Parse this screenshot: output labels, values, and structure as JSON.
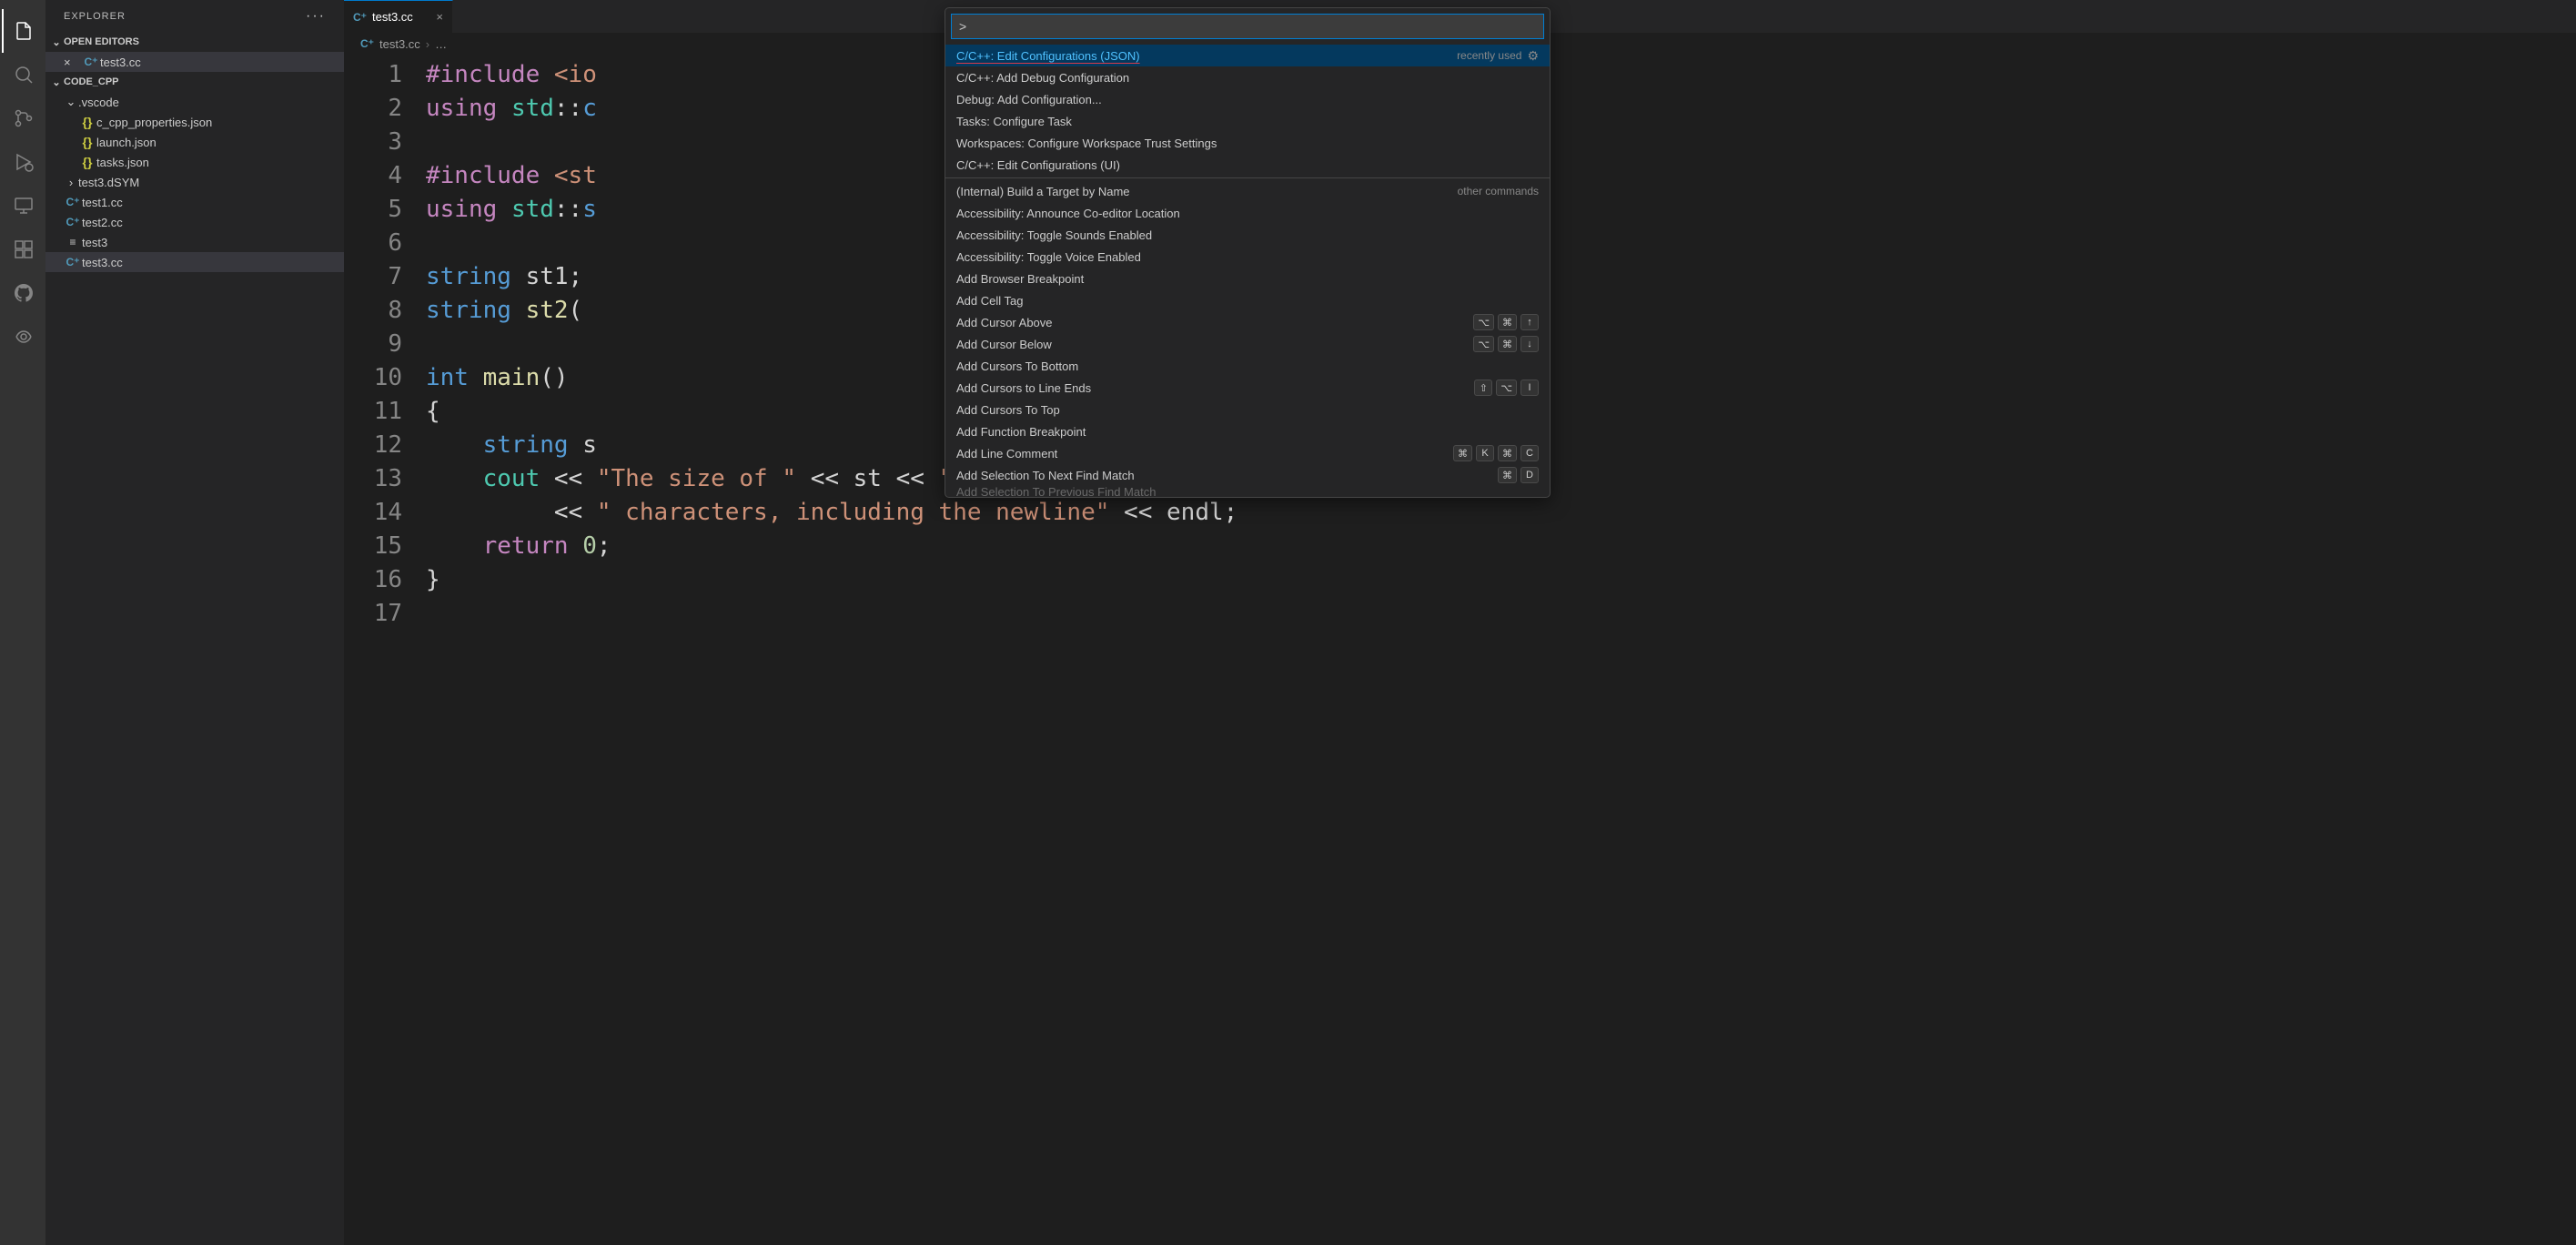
{
  "sidebar": {
    "title": "EXPLORER",
    "sections": {
      "open_editors": {
        "label": "OPEN EDITORS"
      },
      "folder": {
        "label": "CODE_CPP"
      }
    },
    "open_editors_items": [
      {
        "name": "test3.cc",
        "icon": "cpp"
      }
    ],
    "tree": [
      {
        "name": ".vscode",
        "type": "folder",
        "expanded": true,
        "children": [
          {
            "name": "c_cpp_properties.json",
            "icon": "json"
          },
          {
            "name": "launch.json",
            "icon": "json"
          },
          {
            "name": "tasks.json",
            "icon": "json"
          }
        ]
      },
      {
        "name": "test3.dSYM",
        "type": "folder",
        "expanded": false
      },
      {
        "name": "test1.cc",
        "icon": "cpp"
      },
      {
        "name": "test2.cc",
        "icon": "cpp"
      },
      {
        "name": "test3",
        "icon": "text"
      },
      {
        "name": "test3.cc",
        "icon": "cpp",
        "active": true
      }
    ]
  },
  "tabs": [
    {
      "name": "test3.cc",
      "icon": "cpp",
      "active": true
    }
  ],
  "breadcrumb": {
    "file": "test3.cc",
    "more": "…"
  },
  "code": {
    "lines": [
      {
        "n": 1,
        "html": "<span class='tok-keyword'>#include</span> <span class='tok-string'>&lt;io</span>"
      },
      {
        "n": 2,
        "html": "<span class='tok-keyword'>using</span> <span class='tok-ns'>std</span><span class='tok-op'>::</span><span class='tok-type'>c</span>"
      },
      {
        "n": 3,
        "html": ""
      },
      {
        "n": 4,
        "html": "<span class='tok-keyword'>#include</span> <span class='tok-string'>&lt;st</span>"
      },
      {
        "n": 5,
        "html": "<span class='tok-keyword'>using</span> <span class='tok-ns'>std</span><span class='tok-op'>::</span><span class='tok-type'>s</span>"
      },
      {
        "n": 6,
        "html": ""
      },
      {
        "n": 7,
        "html": "<span class='tok-type'>string</span> st1;"
      },
      {
        "n": 8,
        "html": "<span class='tok-type'>string</span> <span class='tok-func'>st2</span>("
      },
      {
        "n": 9,
        "html": ""
      },
      {
        "n": 10,
        "html": "<span class='tok-type'>int</span> <span class='tok-func'>main</span>()"
      },
      {
        "n": 11,
        "html": "{"
      },
      {
        "n": 12,
        "html": "    <span class='tok-type'>string</span> s"
      },
      {
        "n": 13,
        "html": "    <span class='tok-ns'>cout</span> <span class='tok-op'>&lt;&lt;</span> <span class='tok-string'>\"The size of \"</span> <span class='tok-op'>&lt;&lt;</span> st <span class='tok-op'>&lt;&lt;</span> <span class='tok-string'>\"is \"</span> <span class='tok-op'>&lt;&lt;</span> st.<span class='tok-func'>size</span>()"
      },
      {
        "n": 14,
        "html": "         <span class='tok-op'>&lt;&lt;</span> <span class='tok-string'>\" characters, including the newline\"</span> <span class='tok-op'>&lt;&lt;</span> endl;"
      },
      {
        "n": 15,
        "html": "    <span class='tok-keyword'>return</span> <span class='tok-num'>0</span>;"
      },
      {
        "n": 16,
        "html": "}"
      },
      {
        "n": 17,
        "html": ""
      }
    ]
  },
  "palette": {
    "input_value": ">",
    "hint_recently_used": "recently used",
    "hint_other_commands": "other commands",
    "items": [
      {
        "label": "C/C++: Edit Configurations (JSON)",
        "selected": true,
        "hint": "recently_used_gear"
      },
      {
        "label": "C/C++: Add Debug Configuration"
      },
      {
        "label": "Debug: Add Configuration..."
      },
      {
        "label": "Tasks: Configure Task"
      },
      {
        "label": "Workspaces: Configure Workspace Trust Settings"
      },
      {
        "label": "C/C++: Edit Configurations (UI)"
      },
      {
        "divider": true
      },
      {
        "label": "(Internal) Build a Target by Name",
        "hint": "other_commands"
      },
      {
        "label": "Accessibility: Announce Co-editor Location"
      },
      {
        "label": "Accessibility: Toggle Sounds Enabled"
      },
      {
        "label": "Accessibility: Toggle Voice Enabled"
      },
      {
        "label": "Add Browser Breakpoint"
      },
      {
        "label": "Add Cell Tag"
      },
      {
        "label": "Add Cursor Above",
        "keys": [
          "⌥",
          "⌘",
          "↑"
        ]
      },
      {
        "label": "Add Cursor Below",
        "keys": [
          "⌥",
          "⌘",
          "↓"
        ]
      },
      {
        "label": "Add Cursors To Bottom"
      },
      {
        "label": "Add Cursors to Line Ends",
        "keys": [
          "⇧",
          "⌥",
          "I"
        ]
      },
      {
        "label": "Add Cursors To Top"
      },
      {
        "label": "Add Function Breakpoint"
      },
      {
        "label": "Add Line Comment",
        "keys": [
          "⌘",
          "K",
          "⌘",
          "C"
        ]
      },
      {
        "label": "Add Selection To Next Find Match",
        "keys": [
          "⌘",
          "D"
        ]
      },
      {
        "label": "Add Selection To Previous Find Match",
        "cut": true
      }
    ]
  }
}
